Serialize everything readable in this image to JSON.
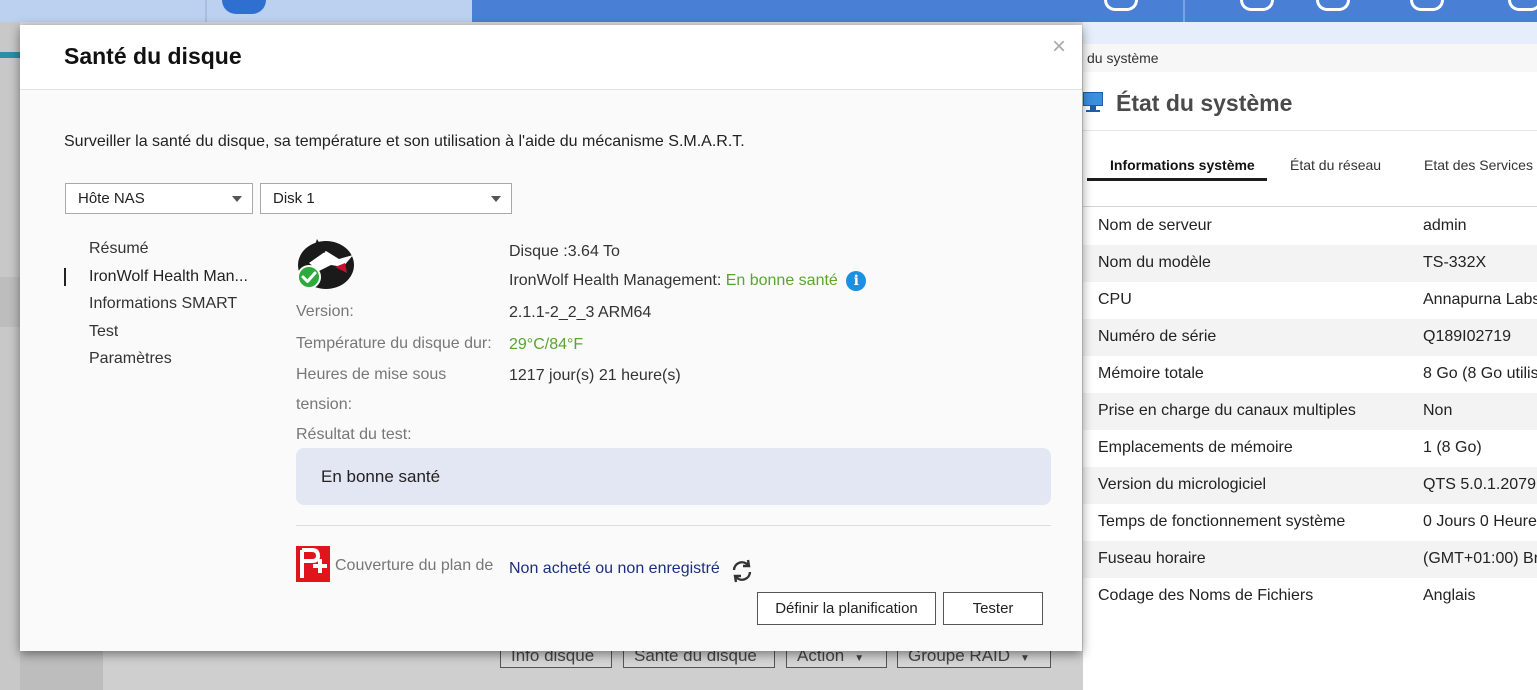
{
  "background": {
    "buttons": [
      {
        "label": "Info disque"
      },
      {
        "label": "Santé du disque"
      },
      {
        "label": "Action"
      },
      {
        "label": "Groupe RAID"
      }
    ]
  },
  "system_panel": {
    "breadcrumb": "du système",
    "title": "État du système",
    "tabs": [
      "Informations système",
      "État du réseau",
      "Etat des Services"
    ],
    "active_tab": "Informations système",
    "rows": [
      {
        "key": "Nom de serveur",
        "value": "admin"
      },
      {
        "key": "Nom du modèle",
        "value": "TS-332X"
      },
      {
        "key": "CPU",
        "value": "Annapurna Labs"
      },
      {
        "key": "Numéro de série",
        "value": "Q189I02719"
      },
      {
        "key": "Mémoire totale",
        "value": "8 Go (8 Go utilis"
      },
      {
        "key": "Prise en charge du canaux multiples",
        "value": "Non"
      },
      {
        "key": "Emplacements de mémoire",
        "value": "1 (8 Go)"
      },
      {
        "key": "Version du micrologiciel",
        "value": "QTS 5.0.1.2079"
      },
      {
        "key": "Temps de fonctionnement système",
        "value": "0 Jours 0 Heure"
      },
      {
        "key": "Fuseau horaire",
        "value": "(GMT+01:00) Br"
      },
      {
        "key": "Codage des Noms de Fichiers",
        "value": "Anglais"
      }
    ]
  },
  "dialog": {
    "title": "Santé du disque",
    "close": "×",
    "description": "Surveiller la santé du disque, sa température et son utilisation à l'aide du mécanisme S.M.A.R.T.",
    "host_select": "Hôte NAS",
    "disk_select": "Disk 1",
    "nav": [
      {
        "label": "Résumé"
      },
      {
        "label": "IronWolf Health Man..."
      },
      {
        "label": "Informations SMART"
      },
      {
        "label": "Test"
      },
      {
        "label": "Paramètres"
      }
    ],
    "active_nav": "IronWolf Health Man...",
    "disk_size": "Disque :3.64 To",
    "ironwolf_label": "IronWolf Health Management:",
    "ironwolf_status": "En bonne santé",
    "version_label": "Version:",
    "version_value": "2.1.1-2_2_3 ARM64",
    "temp_label": "Température du disque dur:",
    "temp_value": "29°C/84°F",
    "hours_label_line1": "Heures de mise sous",
    "hours_label_line2": "tension:",
    "hours_value": "1217 jour(s) 21 heure(s)",
    "result_label": "Résultat du test:",
    "result_value": "En bonne santé",
    "coverage_label": "Couverture du plan de",
    "coverage_value": "Non acheté ou non enregistré",
    "schedule_button": "Définir la planification",
    "test_button": "Tester",
    "colors": {
      "good": "#5aa532",
      "link": "#1b2f7e",
      "info": "#1b8fe0",
      "rescue": "#e0151b"
    }
  }
}
